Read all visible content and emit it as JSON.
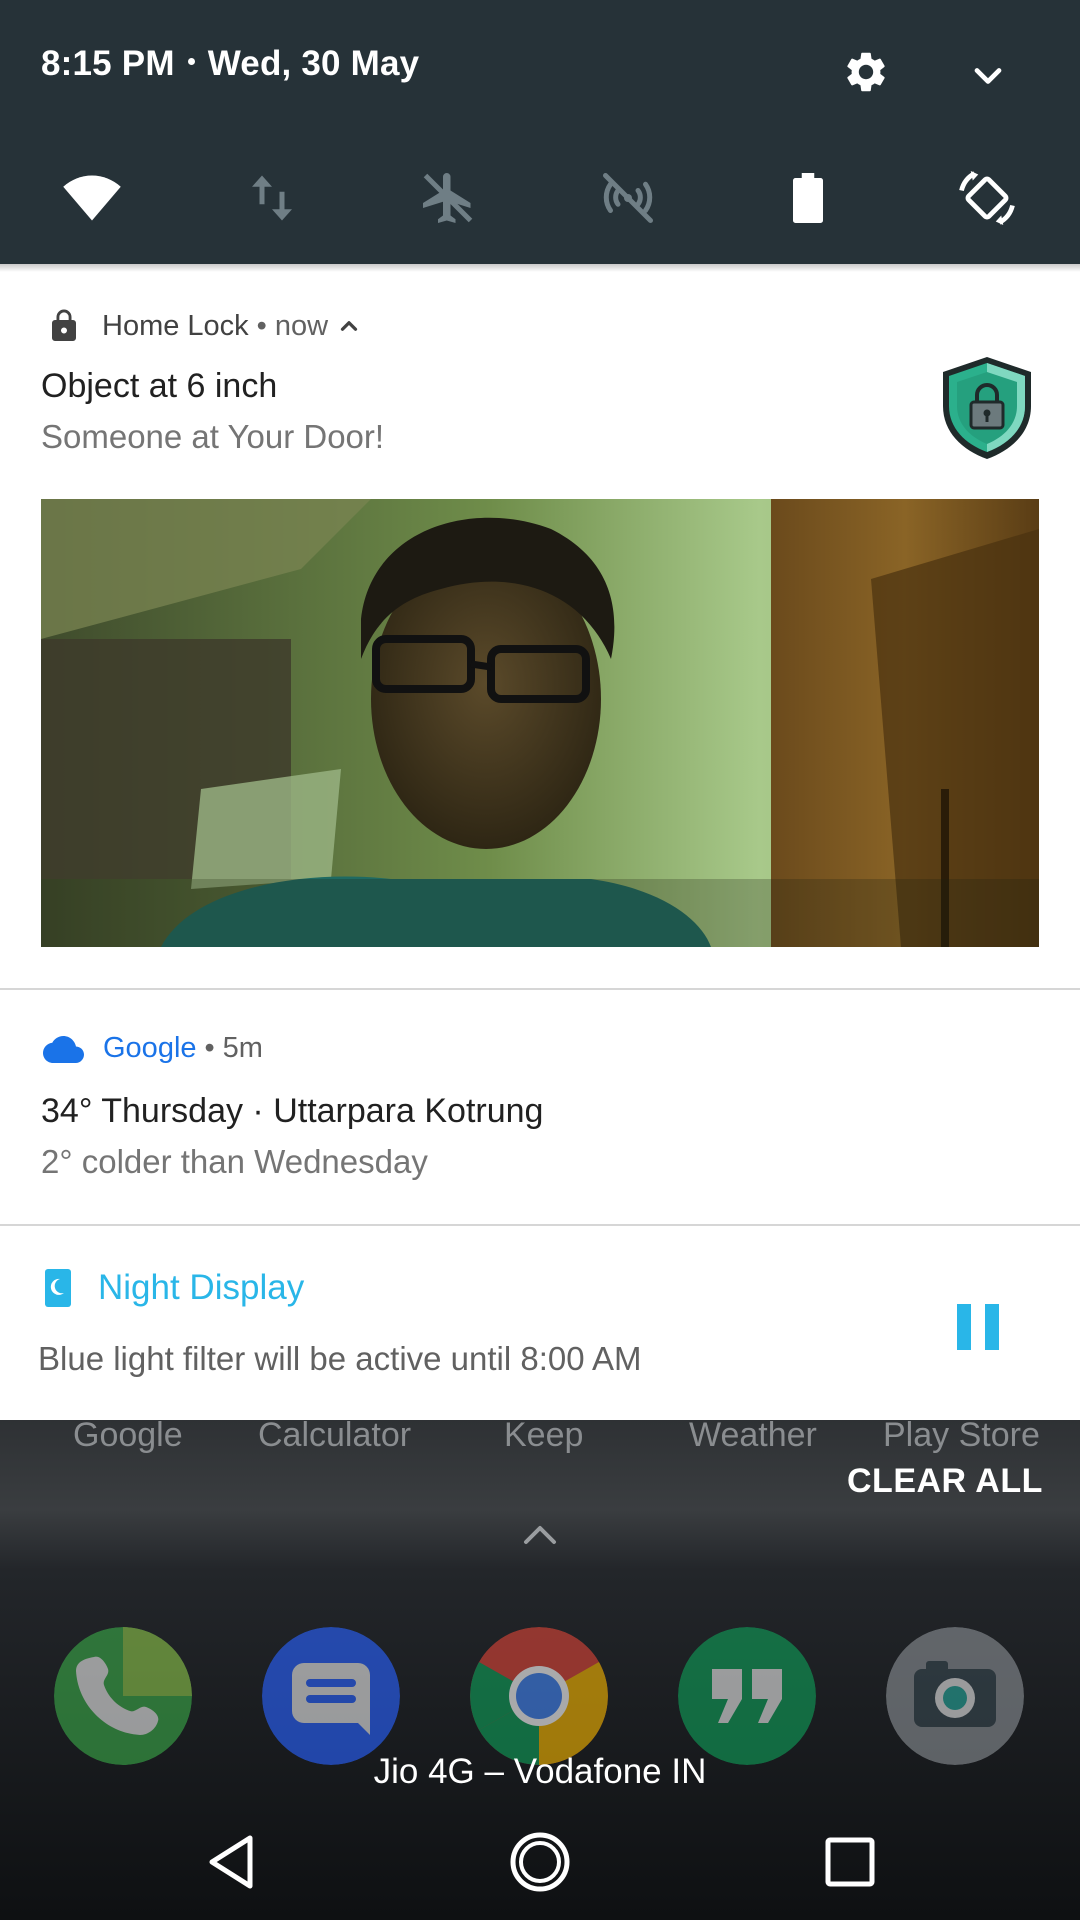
{
  "status": {
    "time": "8:15 PM",
    "date": "Wed, 30 May"
  },
  "quick_tiles": [
    {
      "name": "wifi",
      "icon": "wifi-icon",
      "state": "on"
    },
    {
      "name": "mobile-data",
      "icon": "data-arrows-icon",
      "state": "off"
    },
    {
      "name": "airplane-mode",
      "icon": "airplane-icon",
      "state": "off"
    },
    {
      "name": "hotspot",
      "icon": "hotspot-off-icon",
      "state": "off"
    },
    {
      "name": "battery",
      "icon": "battery-icon",
      "state": "on"
    },
    {
      "name": "auto-rotate",
      "icon": "rotate-icon",
      "state": "on"
    }
  ],
  "notifications": {
    "home_lock": {
      "app": "Home Lock",
      "time": "now",
      "title": "Object at 6 inch",
      "text": "Someone at Your Door!",
      "icon": "lock-icon",
      "large_icon": "shield-lock-icon"
    },
    "google": {
      "app": "Google",
      "time": "5m",
      "title": "34° Thursday · Uttarpara Kotrung",
      "text": "2° colder than Wednesday",
      "icon": "cloud-icon"
    },
    "night_display": {
      "app": "Night Display",
      "text": "Blue light filter will be active until 8:00 AM",
      "icon": "moon-icon",
      "action_icon": "pause-icon"
    },
    "separator": "•"
  },
  "home": {
    "app_labels": [
      "Google",
      "Calculator",
      "Keep",
      "Weather",
      "Play Store"
    ],
    "clear_all": "CLEAR ALL",
    "dock": [
      "phone-icon",
      "messages-icon",
      "chrome-icon",
      "hangouts-icon",
      "camera-icon"
    ],
    "carrier": "Jio 4G – Vodafone IN"
  },
  "colors": {
    "qs_background": "#263238",
    "google_blue": "#1a73e8",
    "night_display_accent": "#29b6e8"
  }
}
